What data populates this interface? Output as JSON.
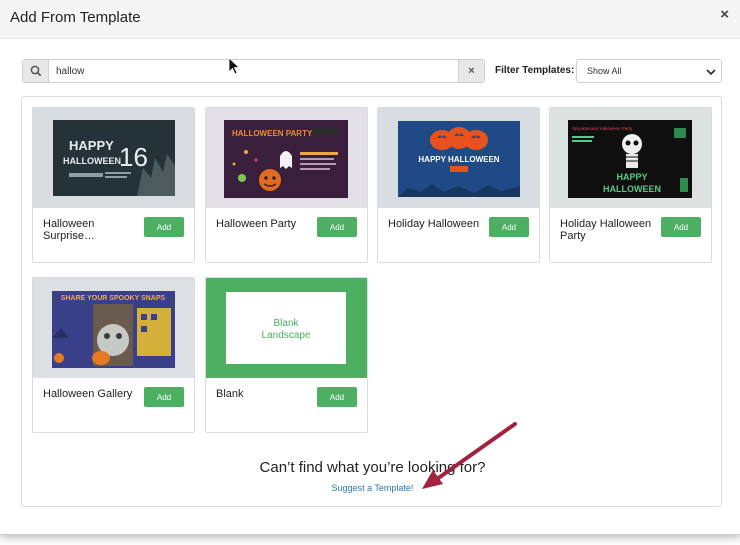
{
  "modal": {
    "title": "Add From Template",
    "close_label": "×"
  },
  "search": {
    "value": "hallow",
    "clear_label": "×",
    "icon": "search-icon"
  },
  "filter": {
    "label": "Filter Templates:",
    "selected": "Show All"
  },
  "templates": [
    {
      "name": "Halloween Surprise…",
      "add_label": "Add"
    },
    {
      "name": "Halloween Party",
      "add_label": "Add"
    },
    {
      "name": "Holiday Halloween",
      "add_label": "Add"
    },
    {
      "name": "Holiday Halloween Party",
      "add_label": "Add"
    },
    {
      "name": "Halloween Gallery",
      "add_label": "Add"
    },
    {
      "name": "Blank",
      "add_label": "Add"
    }
  ],
  "thumbnails": {
    "t1": {
      "line1": "HAPPY",
      "line2": "HALLOWEEN",
      "number": "16"
    },
    "t2": {
      "title": "HALLOWEEN PARTY"
    },
    "t3": {
      "title": "HAPPY HALLOWEEN"
    },
    "t4": {
      "tag": "Spooktacular Halloween Party",
      "line1": "HAPPY",
      "line2": "HALLOWEEN"
    },
    "t5": {
      "title": "SHARE YOUR SPOOKY SNAPS"
    },
    "t6": {
      "line1": "Blank",
      "line2": "Landscape"
    }
  },
  "footer": {
    "cant_find": "Can’t find what you’re looking for?",
    "suggest": "Suggest a Template!"
  },
  "colors": {
    "add_button": "#4caf61",
    "link": "#2a7ab5",
    "annotation_arrow": "#a3223f"
  }
}
